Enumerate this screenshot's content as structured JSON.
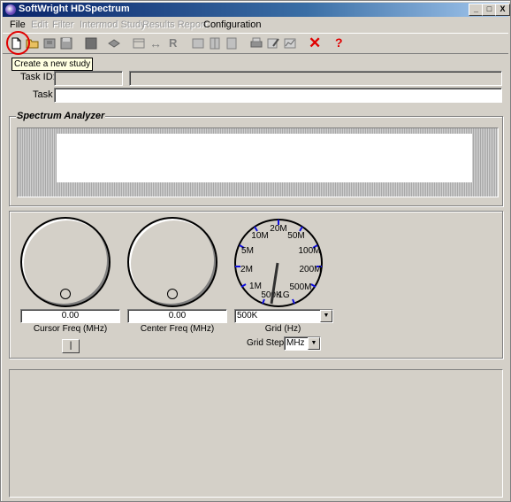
{
  "window": {
    "title": "SoftWright HDSpectrum",
    "min": "_",
    "max": "□",
    "close": "X"
  },
  "menu": [
    {
      "label": "File",
      "enabled": true
    },
    {
      "label": "Edit",
      "enabled": false
    },
    {
      "label": "Filter",
      "enabled": false
    },
    {
      "label": "Intermod Study",
      "enabled": false
    },
    {
      "label": "Results Report",
      "enabled": false
    },
    {
      "label": "Configuration",
      "enabled": true
    }
  ],
  "toolbar": {
    "tooltip": "Create a new study",
    "letter_r": "R",
    "help_glyph": "?",
    "delete_glyph": "✕",
    "arrows_glyph": "↔"
  },
  "task": {
    "id_label": "Task ID:",
    "task_label": "Task",
    "id_value": "",
    "task_value": ""
  },
  "spectrum": {
    "title": "Spectrum Analyzer"
  },
  "controls": {
    "cursor_freq": {
      "value": "0.00",
      "label": "Cursor Freq (MHz)"
    },
    "center_freq": {
      "value": "0.00",
      "label": "Center Freq (MHz)"
    },
    "grid": {
      "value": "500K",
      "label": "Grid (Hz)"
    },
    "grid_step": {
      "label": "Grid Step",
      "value": "MHz"
    },
    "toggle_button": "|",
    "dial_labels": [
      "20M",
      "50M",
      "100M",
      "200M",
      "500M",
      "1G",
      "500K",
      "1M",
      "2M",
      "5M",
      "10M"
    ]
  },
  "colors": {
    "title_start": "#0a246a",
    "title_end": "#a6caf0",
    "delete_red": "#e00000",
    "tick_blue": "#1010e0"
  }
}
